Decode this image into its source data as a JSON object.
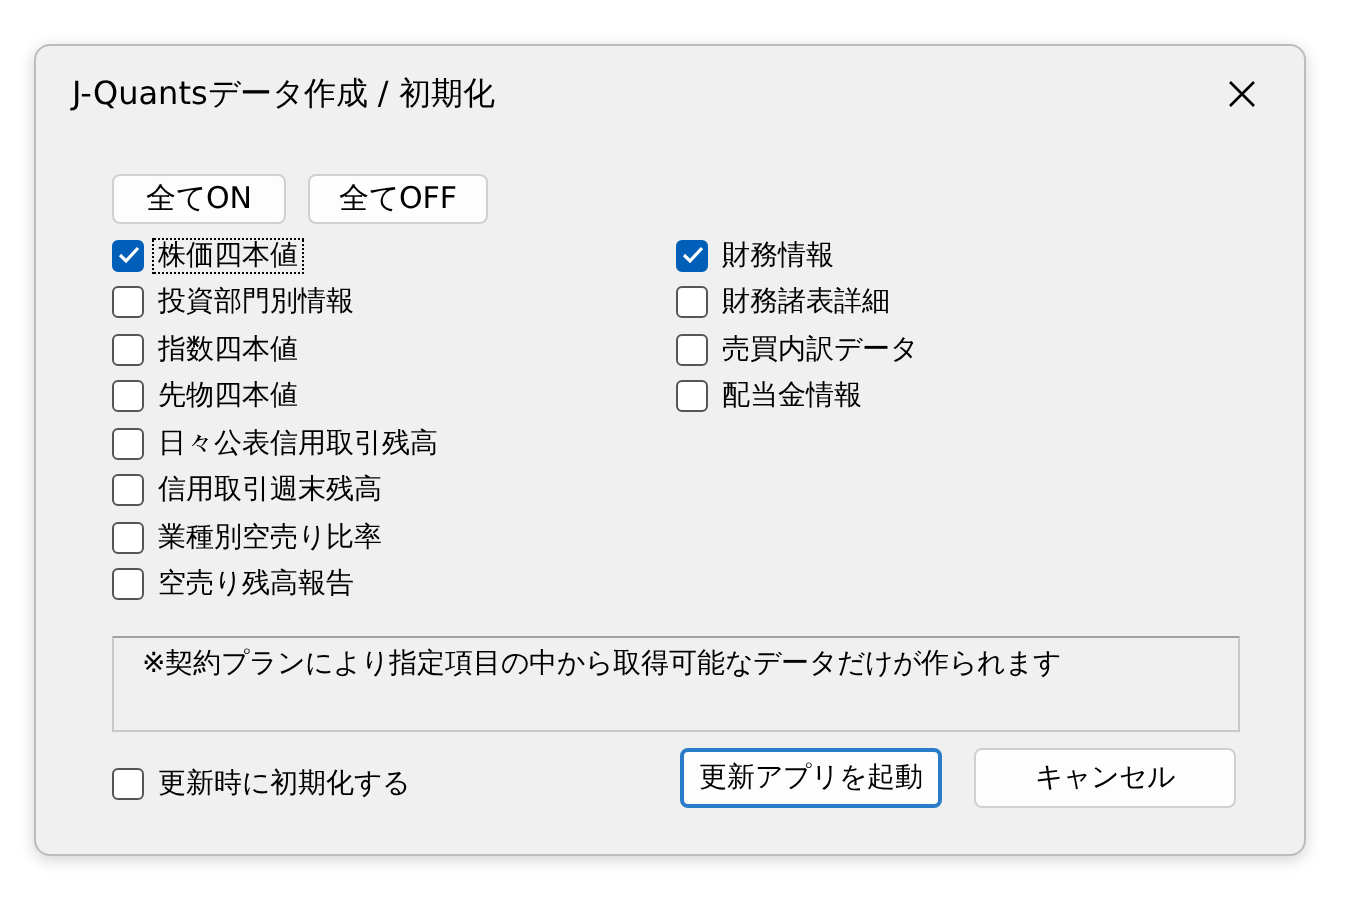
{
  "window": {
    "title": "J-Quantsデータ作成 / 初期化"
  },
  "bulk_buttons": [
    "全てON",
    "全てOFF"
  ],
  "left_items": [
    {
      "label": "株価四本値",
      "checked": true,
      "focused": true
    },
    {
      "label": "投資部門別情報",
      "checked": false,
      "focused": false
    },
    {
      "label": "指数四本値",
      "checked": false,
      "focused": false
    },
    {
      "label": "先物四本値",
      "checked": false,
      "focused": false
    },
    {
      "label": "日々公表信用取引残高",
      "checked": false,
      "focused": false
    },
    {
      "label": "信用取引週末残高",
      "checked": false,
      "focused": false
    },
    {
      "label": "業種別空売り比率",
      "checked": false,
      "focused": false
    },
    {
      "label": "空売り残高報告",
      "checked": false,
      "focused": false
    }
  ],
  "right_items": [
    {
      "label": "財務情報",
      "checked": true,
      "focused": false
    },
    {
      "label": "財務諸表詳細",
      "checked": false,
      "focused": false
    },
    {
      "label": "売買内訳データ",
      "checked": false,
      "focused": false
    },
    {
      "label": "配当金情報",
      "checked": false,
      "focused": false
    }
  ],
  "note": "※契約プランにより指定項目の中から取得可能なデータだけが作られます",
  "reset_option": {
    "label": "更新時に初期化する",
    "checked": false
  },
  "buttons": [
    {
      "label": "更新アプリを起動",
      "default": true
    },
    {
      "label": "キャンセル",
      "default": false
    }
  ]
}
